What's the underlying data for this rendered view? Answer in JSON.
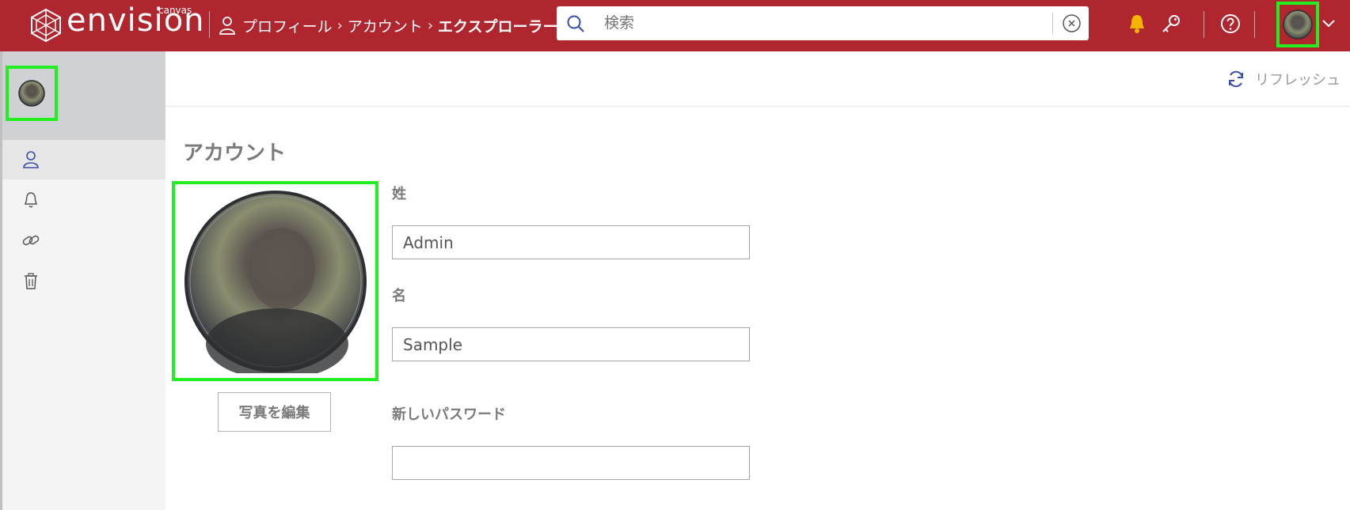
{
  "header": {
    "brand": "envision",
    "brand_sub": "canvas",
    "breadcrumb": [
      "プロフィール",
      "アカウント",
      "エクスプローラー"
    ],
    "search": {
      "placeholder": "検索",
      "value": ""
    },
    "icons": [
      "bell-icon",
      "key-icon",
      "help-icon",
      "avatar",
      "chevron-down-icon"
    ]
  },
  "sidebar": {
    "items": [
      {
        "icon": "user-icon",
        "active": true
      },
      {
        "icon": "bell-icon",
        "active": false
      },
      {
        "icon": "link-icon",
        "active": false
      },
      {
        "icon": "trash-icon",
        "active": false
      }
    ]
  },
  "toolbar": {
    "refresh_label": "リフレッシュ"
  },
  "account": {
    "title": "アカウント",
    "edit_photo_label": "写真を編集",
    "last_name_label": "姓",
    "last_name_value": "Admin",
    "first_name_label": "名",
    "first_name_value": "Sample",
    "new_password_label": "新しいパスワード",
    "new_password_value": ""
  },
  "colors": {
    "topbar": "#b0262e",
    "highlight": "#22ee22",
    "bell": "#f5b400",
    "accent_icon": "#3b4fa8"
  }
}
